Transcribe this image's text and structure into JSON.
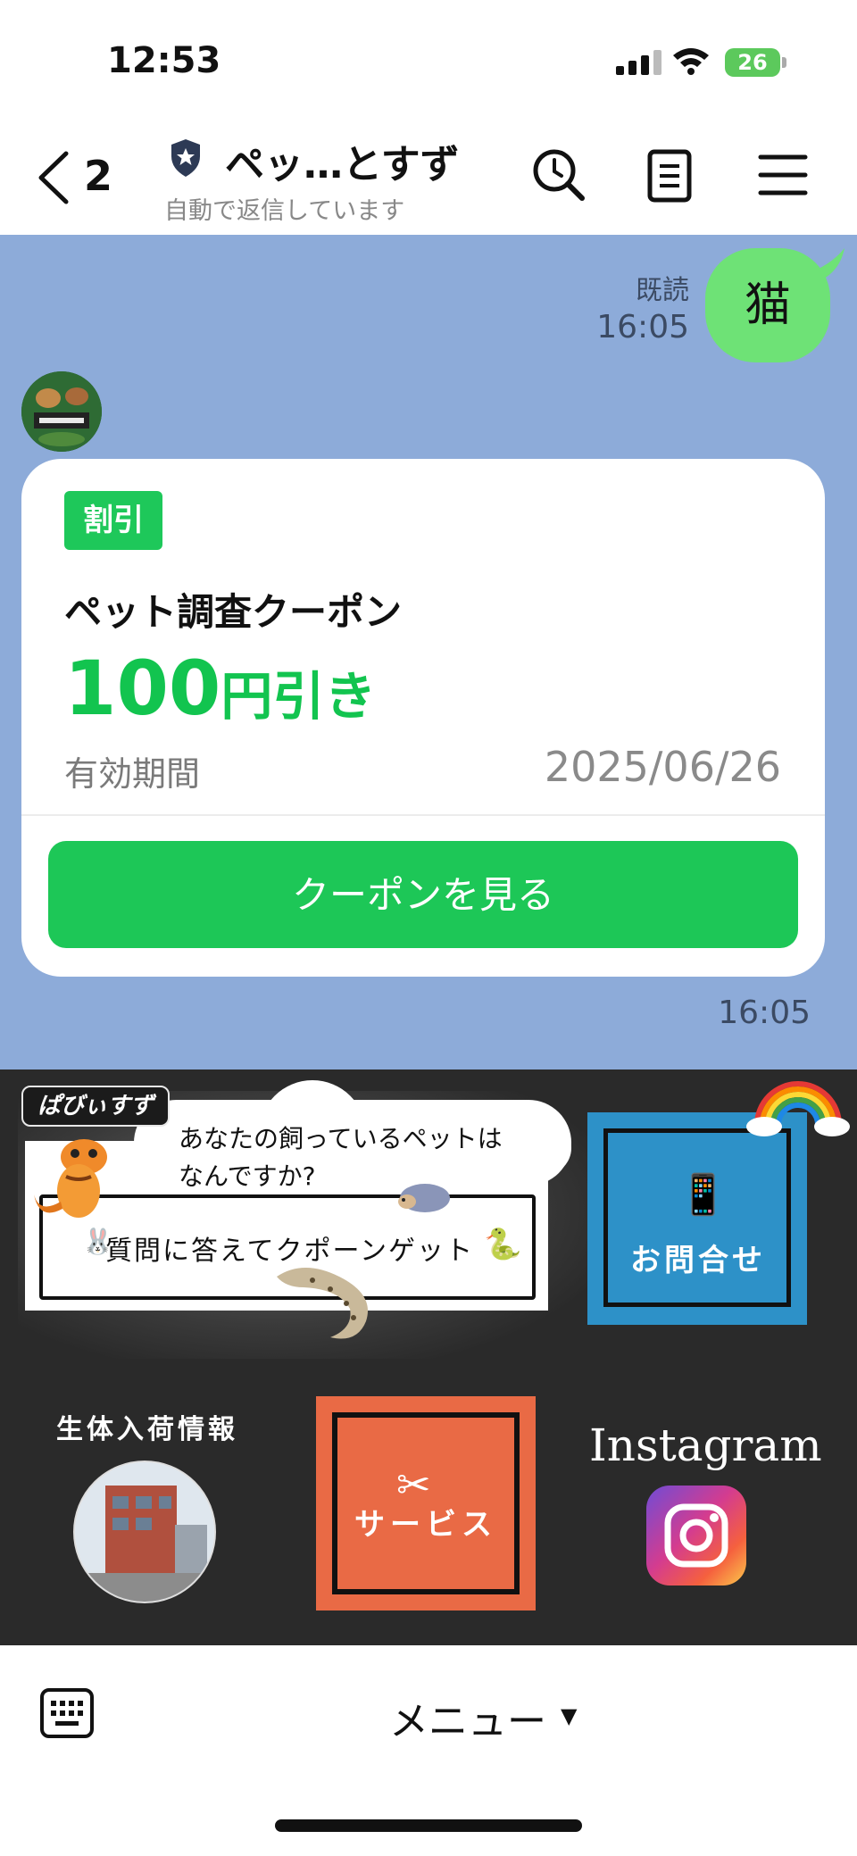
{
  "status_bar": {
    "time": "12:53",
    "battery": "26"
  },
  "header": {
    "back_count": "2",
    "title": "ペッ…とすず",
    "subtitle": "自動で返信しています"
  },
  "chat": {
    "sent_message": {
      "text": "猫",
      "read_label": "既読",
      "time": "16:05"
    },
    "coupon": {
      "badge": "割引",
      "name": "ペット調査クーポン",
      "discount_amount": "100",
      "discount_unit": "円引き",
      "valid_label": "有効期間",
      "valid_date": "2025/06/26",
      "button_label": "クーポンを見る"
    },
    "received_time": "16:05"
  },
  "rich_menu": {
    "logo_text": "ぱびぃすず",
    "question": "あなたの飼っているペットは\nなんですか?",
    "quiz_text": "質問に答えてクポーンゲット",
    "contact_label": "お問合せ",
    "arrivals_label": "生体入荷情報",
    "service_label": "サービス",
    "instagram_label": "Instagram"
  },
  "bottom_bar": {
    "menu_label": "メニュー"
  },
  "colors": {
    "chat_bg": "#8dabd9",
    "bubble": "#6ee276",
    "line_green": "#1dc757",
    "rich_menu_bg": "#2a2a2a",
    "contact_tile": "#2d91c8",
    "service_tile": "#e96a45"
  },
  "icons": [
    "back-chevron-icon",
    "shield-star-icon",
    "search-clock-icon",
    "notes-icon",
    "hamburger-menu-icon",
    "keyboard-icon",
    "instagram-icon",
    "scissors-icon",
    "phone-icon",
    "rainbow-icon"
  ]
}
